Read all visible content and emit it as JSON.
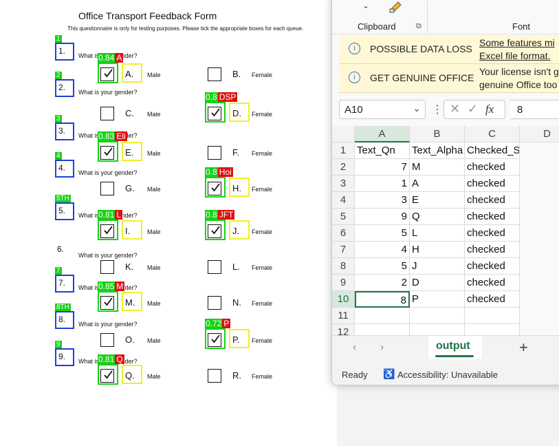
{
  "document": {
    "title": "Office Transport Feedback Form",
    "subtitle": "This questionnaire is only for testing purposes. Please tick the appropriate boxes for each queue.",
    "questions": [
      {
        "num": "1.",
        "tag": "1",
        "text": "What is your gender?"
      },
      {
        "num": "2.",
        "tag": "2",
        "text": "What is your gender?"
      },
      {
        "num": "3.",
        "tag": "3",
        "text": "What is your gender?"
      },
      {
        "num": "4.",
        "tag": "4",
        "text": "What is your gender?"
      },
      {
        "num": "5.",
        "tag": "5TH",
        "text": "What is your gender?"
      },
      {
        "num": "6.",
        "tag": "",
        "text": "What is your gender?"
      },
      {
        "num": "7.",
        "tag": "7",
        "text": "What is your gender?"
      },
      {
        "num": "8.",
        "tag": "8TH",
        "text": "What is your gender?"
      },
      {
        "num": "9.",
        "tag": "9",
        "text": "What is your gender?"
      }
    ],
    "options": [
      {
        "letter": "A.",
        "word": "Male",
        "checked": true,
        "conf": "0.84",
        "tag": "A"
      },
      {
        "letter": "B.",
        "word": "Female",
        "checked": false,
        "conf": "",
        "tag": ""
      },
      {
        "letter": "C.",
        "word": "Male",
        "checked": false,
        "conf": "",
        "tag": ""
      },
      {
        "letter": "D.",
        "word": "Female",
        "checked": true,
        "conf": "0.8",
        "tag": "DSP"
      },
      {
        "letter": "E.",
        "word": "Male",
        "checked": true,
        "conf": "0.83",
        "tag": "Eli"
      },
      {
        "letter": "F.",
        "word": "Female",
        "checked": false,
        "conf": "",
        "tag": ""
      },
      {
        "letter": "G.",
        "word": "Male",
        "checked": false,
        "conf": "",
        "tag": ""
      },
      {
        "letter": "H.",
        "word": "Female",
        "checked": true,
        "conf": "0.8",
        "tag": "Hoi"
      },
      {
        "letter": "I.",
        "word": "Male",
        "checked": true,
        "conf": "0.81",
        "tag": "L"
      },
      {
        "letter": "J.",
        "word": "Female",
        "checked": true,
        "conf": "0.8",
        "tag": "JFT"
      },
      {
        "letter": "K.",
        "word": "Male",
        "checked": false,
        "conf": "",
        "tag": ""
      },
      {
        "letter": "L.",
        "word": "Female",
        "checked": false,
        "conf": "",
        "tag": ""
      },
      {
        "letter": "M.",
        "word": "Male",
        "checked": true,
        "conf": "0.85",
        "tag": "M"
      },
      {
        "letter": "N.",
        "word": "Female",
        "checked": false,
        "conf": "",
        "tag": ""
      },
      {
        "letter": "O.",
        "word": "Male",
        "checked": false,
        "conf": "",
        "tag": ""
      },
      {
        "letter": "P.",
        "word": "Female",
        "checked": true,
        "conf": "0.72",
        "tag": "P"
      },
      {
        "letter": "Q.",
        "word": "Male",
        "checked": true,
        "conf": "0.81",
        "tag": "Q"
      },
      {
        "letter": "R.",
        "word": "Female",
        "checked": false,
        "conf": "",
        "tag": ""
      }
    ]
  },
  "excel": {
    "ribbon": {
      "clipboard": "Clipboard",
      "font": "Font",
      "dropdown_icon": "chevron-down-icon",
      "paste_icon": "paste-brush-icon"
    },
    "messages": [
      {
        "icon": "info-icon",
        "title": "POSSIBLE DATA LOSS",
        "line1": "Some features mi",
        "line2": "Excel file format."
      },
      {
        "icon": "info-icon",
        "title": "GET GENUINE OFFICE",
        "line1": "Your license isn't g",
        "line2": "genuine Office too"
      }
    ],
    "name_box": "A10",
    "formula_value": "8",
    "fx": "fx",
    "columns": [
      "A",
      "B",
      "C",
      "D"
    ],
    "rows": [
      [
        "1",
        "Text_Qn",
        "Text_Alpha",
        "Checked_Status"
      ],
      [
        "2",
        "7",
        "M",
        "checked"
      ],
      [
        "3",
        "1",
        "A",
        "checked"
      ],
      [
        "4",
        "3",
        "E",
        "checked"
      ],
      [
        "5",
        "9",
        "Q",
        "checked"
      ],
      [
        "6",
        "5",
        "L",
        "checked"
      ],
      [
        "7",
        "4",
        "H",
        "checked"
      ],
      [
        "8",
        "5",
        "J",
        "checked"
      ],
      [
        "9",
        "2",
        "D",
        "checked"
      ],
      [
        "10",
        "8",
        "P",
        "checked"
      ],
      [
        "11",
        "",
        "",
        ""
      ],
      [
        "12",
        "",
        "",
        ""
      ]
    ],
    "sheet_tab": "output",
    "add_sheet": "+",
    "status": "Ready",
    "accessibility": "Accessibility: Unavailable",
    "accent": "#217346"
  }
}
